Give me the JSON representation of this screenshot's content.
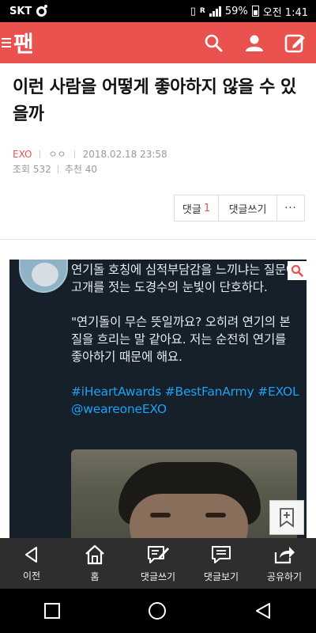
{
  "status_bar": {
    "carrier": "SKT",
    "battery": "59%",
    "time": "오전 1:41"
  },
  "app": {
    "logo": "팬",
    "brand_color": "#e9524f"
  },
  "article": {
    "title": "이런 사람을 어떻게 좋아하지 않을 수 있을까",
    "category": "EXO",
    "author": "ㅇㅇ",
    "date": "2018.02.18 23:58",
    "views": "조회 532",
    "recommend": "추천 40"
  },
  "actions": {
    "reply_label": "댓글",
    "reply_count": "1",
    "write_label": "댓글쓰기",
    "more_label": "···"
  },
  "post_image": {
    "tweet_line1": "연기돌 호칭에 심적부담감을 느끼냐는 질문에 고개를 젓는 도경수의 눈빛이 단호하다.",
    "tweet_line2": "\"연기돌이 무슨 뜻일까요? 오히려 연기의 본질을 흐리는 말 같아요. 저는 순전히 연기를 좋아하기 때문에 해요.",
    "hashtags": "#iHeartAwards #BestFanArmy #EXOL @weareoneEXO"
  },
  "toolbar": [
    {
      "label": "이전",
      "icon": "back-icon"
    },
    {
      "label": "홈",
      "icon": "home-icon"
    },
    {
      "label": "댓글쓰기",
      "icon": "comment-write-icon"
    },
    {
      "label": "댓글보기",
      "icon": "comment-view-icon"
    },
    {
      "label": "공유하기",
      "icon": "share-icon"
    }
  ]
}
